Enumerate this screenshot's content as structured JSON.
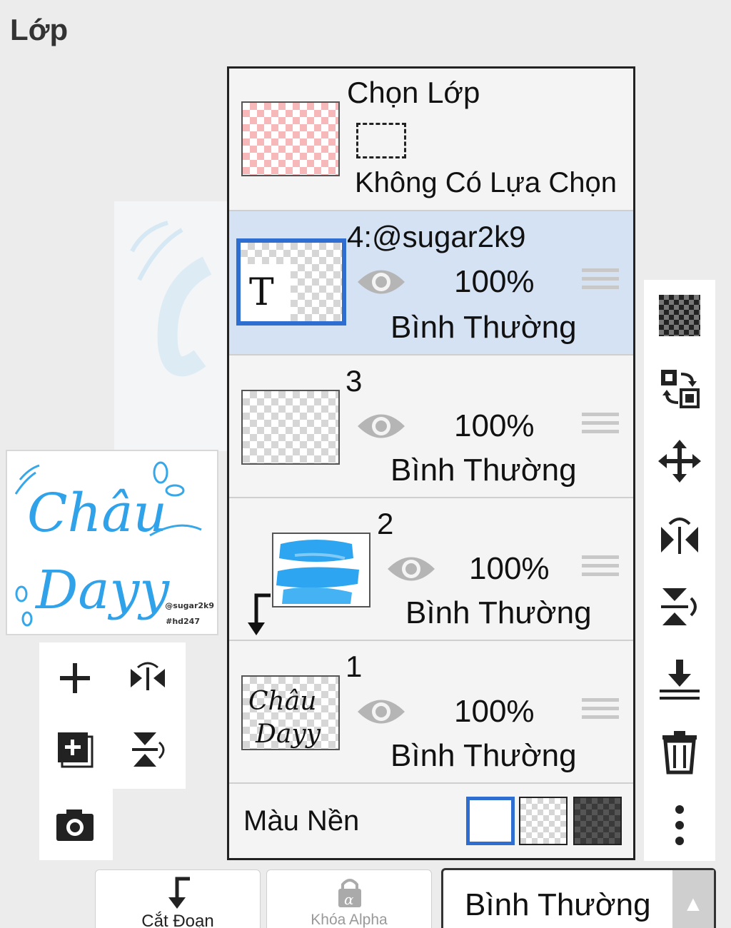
{
  "header": {
    "title": "Lớp"
  },
  "preview": {
    "watermark_user": "@sugar2k9",
    "watermark_tag": "#hd247"
  },
  "selection": {
    "title": "Chọn Lớp",
    "status": "Không Có Lựa Chọn"
  },
  "layers": [
    {
      "name": "4:@sugar2k9",
      "opacity": "100%",
      "blend": "Bình Thường",
      "selected": true,
      "thumb_icon": "T"
    },
    {
      "name": "3",
      "opacity": "100%",
      "blend": "Bình Thường",
      "selected": false
    },
    {
      "name": "2",
      "opacity": "100%",
      "blend": "Bình Thường",
      "selected": false,
      "clipped": true
    },
    {
      "name": "1",
      "opacity": "100%",
      "blend": "Bình Thường",
      "selected": false
    }
  ],
  "background": {
    "label": "Màu Nền",
    "options": [
      "white",
      "transparent",
      "dark-checker"
    ],
    "selected": "white"
  },
  "bottom_bar": {
    "clip_label": "Cắt Đoạn",
    "alpha_lock_label": "Khóa Alpha",
    "blend_mode": "Bình Thường"
  },
  "colors": {
    "accent": "#2f6ed1",
    "selected_row": "#d5e2f4",
    "icon_gray": "#b5b5b5"
  },
  "icons": {
    "left": [
      "add-layer-icon",
      "flip-horizontal-icon",
      "add-layer-copy-icon",
      "flip-vertical-icon",
      "camera-icon"
    ],
    "right": [
      "checker-icon",
      "swap-icon",
      "move-icon",
      "flip-horizontal-icon",
      "flip-vertical-icon",
      "merge-down-icon",
      "trash-icon",
      "more-icon"
    ]
  }
}
